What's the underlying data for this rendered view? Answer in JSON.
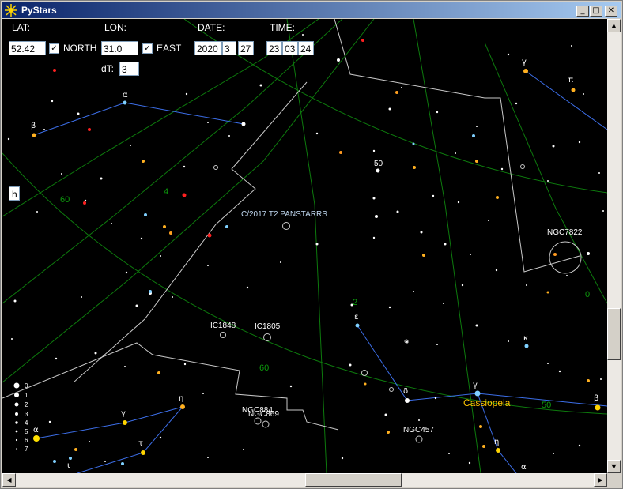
{
  "window": {
    "title": "PyStars",
    "buttons": {
      "minimize": "_",
      "maximize": "□",
      "close": "✕"
    }
  },
  "controls": {
    "lat_label": "LAT:",
    "lat_value": "52.42",
    "north_checked": "✓",
    "north_label": "NORTH",
    "lon_label": "LON:",
    "lon_value": "31.0",
    "east_checked": "✓",
    "east_label": "EAST",
    "date_label": "DATE:",
    "date_year": "2020",
    "date_month": "3",
    "date_day": "27",
    "time_label": "TIME:",
    "time_hour": "23",
    "time_min": "03",
    "time_sec": "24",
    "dt_label": "dT:",
    "dt_value": "3",
    "h_button": "h"
  },
  "sky": {
    "grid_labels": {
      "dec60_a": "60",
      "dec60_b": "60",
      "ra4": "4",
      "ra0": "0",
      "ra2": "2",
      "dec50": "50"
    },
    "objects": {
      "comet": "C/2017 T2 PANSTARRS",
      "ngc7822": "NGC7822",
      "ic1848": "IC1848",
      "ic1805": "IC1805",
      "ngc884": "NGC884",
      "ngc869": "NGC869",
      "ngc457": "NGC457"
    },
    "star_number": "50",
    "constellation": "Cassiopeia",
    "greek": {
      "alpha_top": "α",
      "beta_left": "β",
      "gamma_right": "γ",
      "pi_right": "π",
      "epsilon": "ε",
      "kappa": "κ",
      "delta": "δ",
      "gamma_cas": "γ",
      "eta_cas": "η",
      "alpha_cas": "α",
      "beta_right": "β",
      "alpha_per": "α",
      "gamma_per": "γ",
      "eta_per": "η",
      "tau_per": "τ",
      "iota_per": "ι"
    },
    "magnitude_legend": [
      "0",
      "1",
      "2",
      "3",
      "4",
      "5",
      "6",
      "7"
    ],
    "colors": {
      "grid": "#0d7a0d",
      "boundary": "#c8c8c8",
      "lines": "#3c6ee8",
      "constellation_name": "#ffc400"
    }
  },
  "scroll": {
    "up": "▲",
    "down": "▼",
    "left": "◀",
    "right": "▶"
  }
}
